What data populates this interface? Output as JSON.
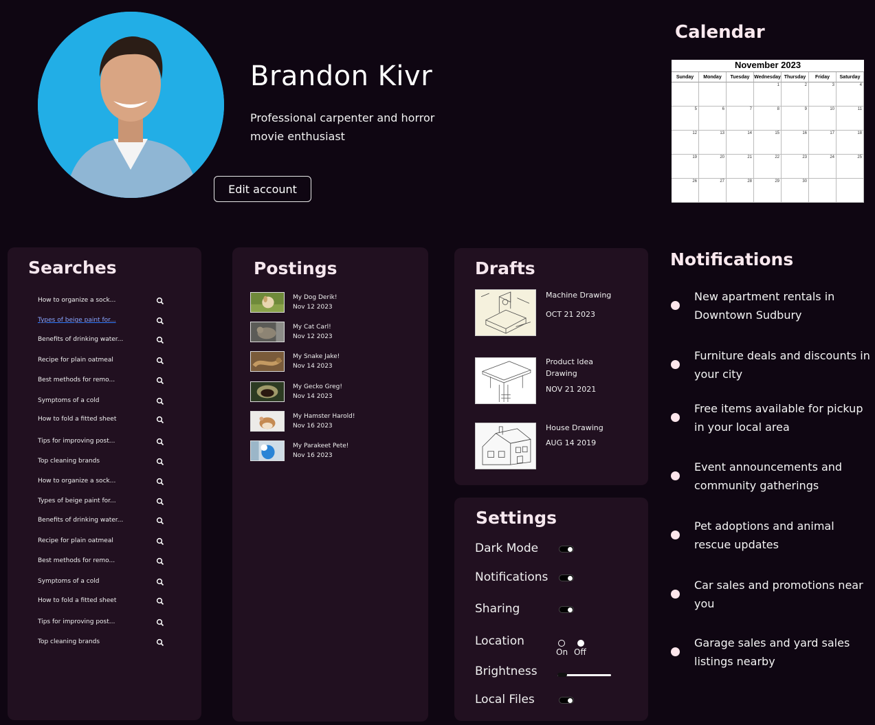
{
  "profile": {
    "name": "Brandon Kivr",
    "bio": "Professional carpenter and horror movie enthusiast",
    "edit_label": "Edit account"
  },
  "calendar": {
    "title": "Calendar",
    "month": "November 2023",
    "weekdays": [
      "Sunday",
      "Monday",
      "Tuesday",
      "Wednesday",
      "Thursday",
      "Friday",
      "Saturday"
    ],
    "cells": [
      "",
      "",
      "",
      "1",
      "2",
      "3",
      "4",
      "5",
      "6",
      "7",
      "8",
      "9",
      "10",
      "11",
      "12",
      "13",
      "14",
      "15",
      "16",
      "17",
      "18",
      "19",
      "20",
      "21",
      "22",
      "23",
      "24",
      "25",
      "26",
      "27",
      "28",
      "29",
      "30",
      "",
      ""
    ]
  },
  "searches": {
    "title": "Searches",
    "items": [
      "How to organize a sock...",
      "Types of beige paint for...",
      "Benefits of drinking water...",
      "Recipe for plain oatmeal",
      "Best methods for remo...",
      "Symptoms of a cold",
      "How to fold a fitted sheet",
      "Tips for improving post...",
      "Top cleaning brands",
      "How to organize a sock...",
      "Types of beige paint for...",
      "Benefits of drinking water...",
      "Recipe for plain oatmeal",
      "Best methods for remo...",
      "Symptoms of a cold",
      "How to fold a fitted sheet",
      "Tips for improving post...",
      "Top cleaning brands"
    ],
    "icon": "search-icon"
  },
  "postings": {
    "title": "Postings",
    "items": [
      {
        "title": "My Dog Derik!",
        "date": "Nov 12 2023"
      },
      {
        "title": "My Cat Carl!",
        "date": "Nov 12 2023"
      },
      {
        "title": "My Snake Jake!",
        "date": "Nov 14 2023"
      },
      {
        "title": "My Gecko Greg!",
        "date": "Nov 14 2023"
      },
      {
        "title": "My Hamster Harold!",
        "date": "Nov 16 2023"
      },
      {
        "title": "My Parakeet Pete!",
        "date": "Nov 16 2023"
      }
    ]
  },
  "drafts": {
    "title": "Drafts",
    "items": [
      {
        "title": "Machine Drawing",
        "date": "OCT 21 2023"
      },
      {
        "title": "Product Idea Drawing",
        "date": "NOV 21 2021"
      },
      {
        "title": "House Drawing",
        "date": "AUG 14 2019"
      }
    ]
  },
  "settings": {
    "title": "Settings",
    "dark_mode": "Dark Mode",
    "notifications": "Notifications",
    "sharing": "Sharing",
    "location": "Location",
    "location_on": "On",
    "location_off": "Off",
    "brightness": "Brightness",
    "local_files": "Local Files"
  },
  "notifications": {
    "title": "Notifications",
    "items": [
      "New apartment rentals in Downtown Sudbury",
      "Furniture deals and discounts in your city",
      "Free items available for pickup in your local area",
      "Event announcements and community gatherings",
      "Pet adoptions and animal rescue updates",
      "Car sales and promotions near you",
      "Garage sales and yard sales listings nearby"
    ]
  },
  "colors": {
    "background": "#0f0612",
    "panel": "#211020",
    "accent_dot": "#fde6ec"
  }
}
